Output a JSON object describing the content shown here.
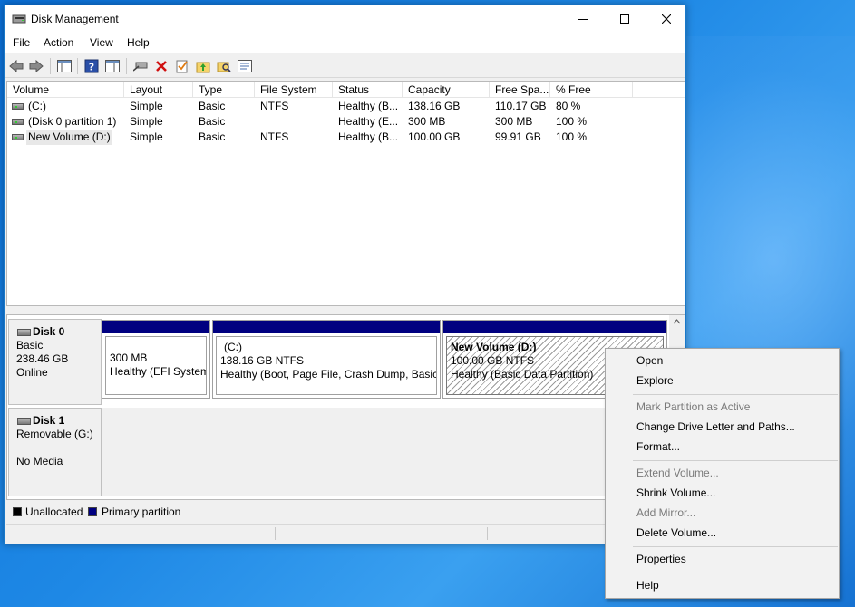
{
  "window": {
    "title": "Disk Management"
  },
  "menu": [
    "File",
    "Action",
    "View",
    "Help"
  ],
  "toolbar": {
    "icons": [
      "back-icon",
      "forward-icon",
      "console-tree-icon",
      "help-icon",
      "show-pane-icon",
      "connect-icon",
      "delete-icon",
      "check-icon",
      "folder-up-icon",
      "search-folder-icon",
      "properties-icon"
    ]
  },
  "volumes": {
    "columns": [
      "Volume",
      "Layout",
      "Type",
      "File System",
      "Status",
      "Capacity",
      "Free Spa...",
      "% Free"
    ],
    "rows": [
      {
        "volume": "(C:)",
        "layout": "Simple",
        "type": "Basic",
        "fs": "NTFS",
        "status": "Healthy (B...",
        "capacity": "138.16 GB",
        "free": "110.17 GB",
        "pct": "80 %"
      },
      {
        "volume": "(Disk 0 partition 1)",
        "layout": "Simple",
        "type": "Basic",
        "fs": "",
        "status": "Healthy (E...",
        "capacity": "300 MB",
        "free": "300 MB",
        "pct": "100 %"
      },
      {
        "volume": "New Volume (D:)",
        "layout": "Simple",
        "type": "Basic",
        "fs": "NTFS",
        "status": "Healthy (B...",
        "capacity": "100.00 GB",
        "free": "99.91 GB",
        "pct": "100 %"
      }
    ]
  },
  "disks": [
    {
      "name": "Disk 0",
      "type": "Basic",
      "size": "238.46 GB",
      "state": "Online",
      "partitions": [
        {
          "title": "",
          "size": "300 MB",
          "status": "Healthy (EFI System"
        },
        {
          "title": "(C:)",
          "size": "138.16 GB NTFS",
          "status": "Healthy (Boot, Page File, Crash Dump, Basic D"
        },
        {
          "title": "New Volume  (D:)",
          "size": "100.00 GB NTFS",
          "status": "Healthy (Basic Data Partition)"
        }
      ]
    },
    {
      "name": "Disk 1",
      "type": "Removable (G:)",
      "size": "",
      "state": "No Media"
    }
  ],
  "legend": [
    {
      "label": "Unallocated",
      "color": "#000000"
    },
    {
      "label": "Primary partition",
      "color": "#000080"
    }
  ],
  "context_menu": [
    {
      "label": "Open",
      "enabled": true
    },
    {
      "label": "Explore",
      "enabled": true
    },
    {
      "label": "Mark Partition as Active",
      "enabled": false
    },
    {
      "label": "Change Drive Letter and Paths...",
      "enabled": true
    },
    {
      "label": "Format...",
      "enabled": true
    },
    {
      "label": "Extend Volume...",
      "enabled": false
    },
    {
      "label": "Shrink Volume...",
      "enabled": true
    },
    {
      "label": "Add Mirror...",
      "enabled": false
    },
    {
      "label": "Delete Volume...",
      "enabled": true
    },
    {
      "label": "Properties",
      "enabled": true
    },
    {
      "label": "Help",
      "enabled": true
    }
  ]
}
